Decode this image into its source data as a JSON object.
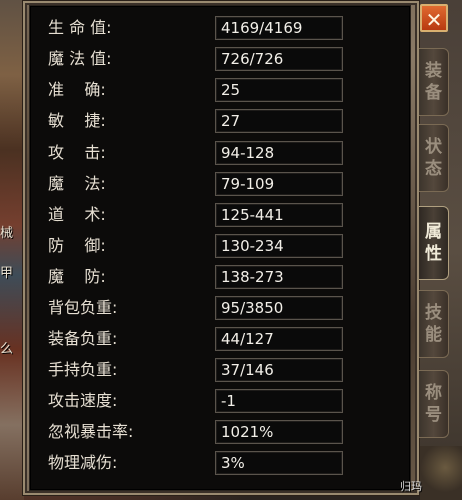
{
  "panel": {
    "stats": [
      {
        "label": "生 命 值:",
        "value": "4169/4169"
      },
      {
        "label": "魔 法 值:",
        "value": "726/726"
      },
      {
        "label": "准    确:",
        "value": "25"
      },
      {
        "label": "敏    捷:",
        "value": "27"
      },
      {
        "label": "攻    击:",
        "value": "94-128"
      },
      {
        "label": "魔    法:",
        "value": "79-109"
      },
      {
        "label": "道    术:",
        "value": "125-441"
      },
      {
        "label": "防    御:",
        "value": "130-234"
      },
      {
        "label": "魔    防:",
        "value": "138-273"
      },
      {
        "label": "背包负重:",
        "value": "95/3850"
      },
      {
        "label": "装备负重:",
        "value": "44/127"
      },
      {
        "label": "手持负重:",
        "value": "37/146"
      },
      {
        "label": "攻击速度:",
        "value": "-1"
      },
      {
        "label": "忽视暴击率:",
        "value": "1021%"
      },
      {
        "label": "物理减伤:",
        "value": "3%"
      }
    ]
  },
  "tabs": [
    {
      "id": "equipment",
      "chars": [
        "装",
        "备"
      ],
      "active": false
    },
    {
      "id": "status",
      "chars": [
        "状",
        "态"
      ],
      "active": false
    },
    {
      "id": "attributes",
      "chars": [
        "属",
        "性"
      ],
      "active": true
    },
    {
      "id": "skills",
      "chars": [
        "技",
        "能"
      ],
      "active": false
    },
    {
      "id": "titles",
      "chars": [
        "称",
        "号"
      ],
      "active": false
    }
  ],
  "close_label": "✕",
  "left_fragments": [
    "械",
    "甲",
    "么"
  ],
  "bottom_fragment": "归玛"
}
